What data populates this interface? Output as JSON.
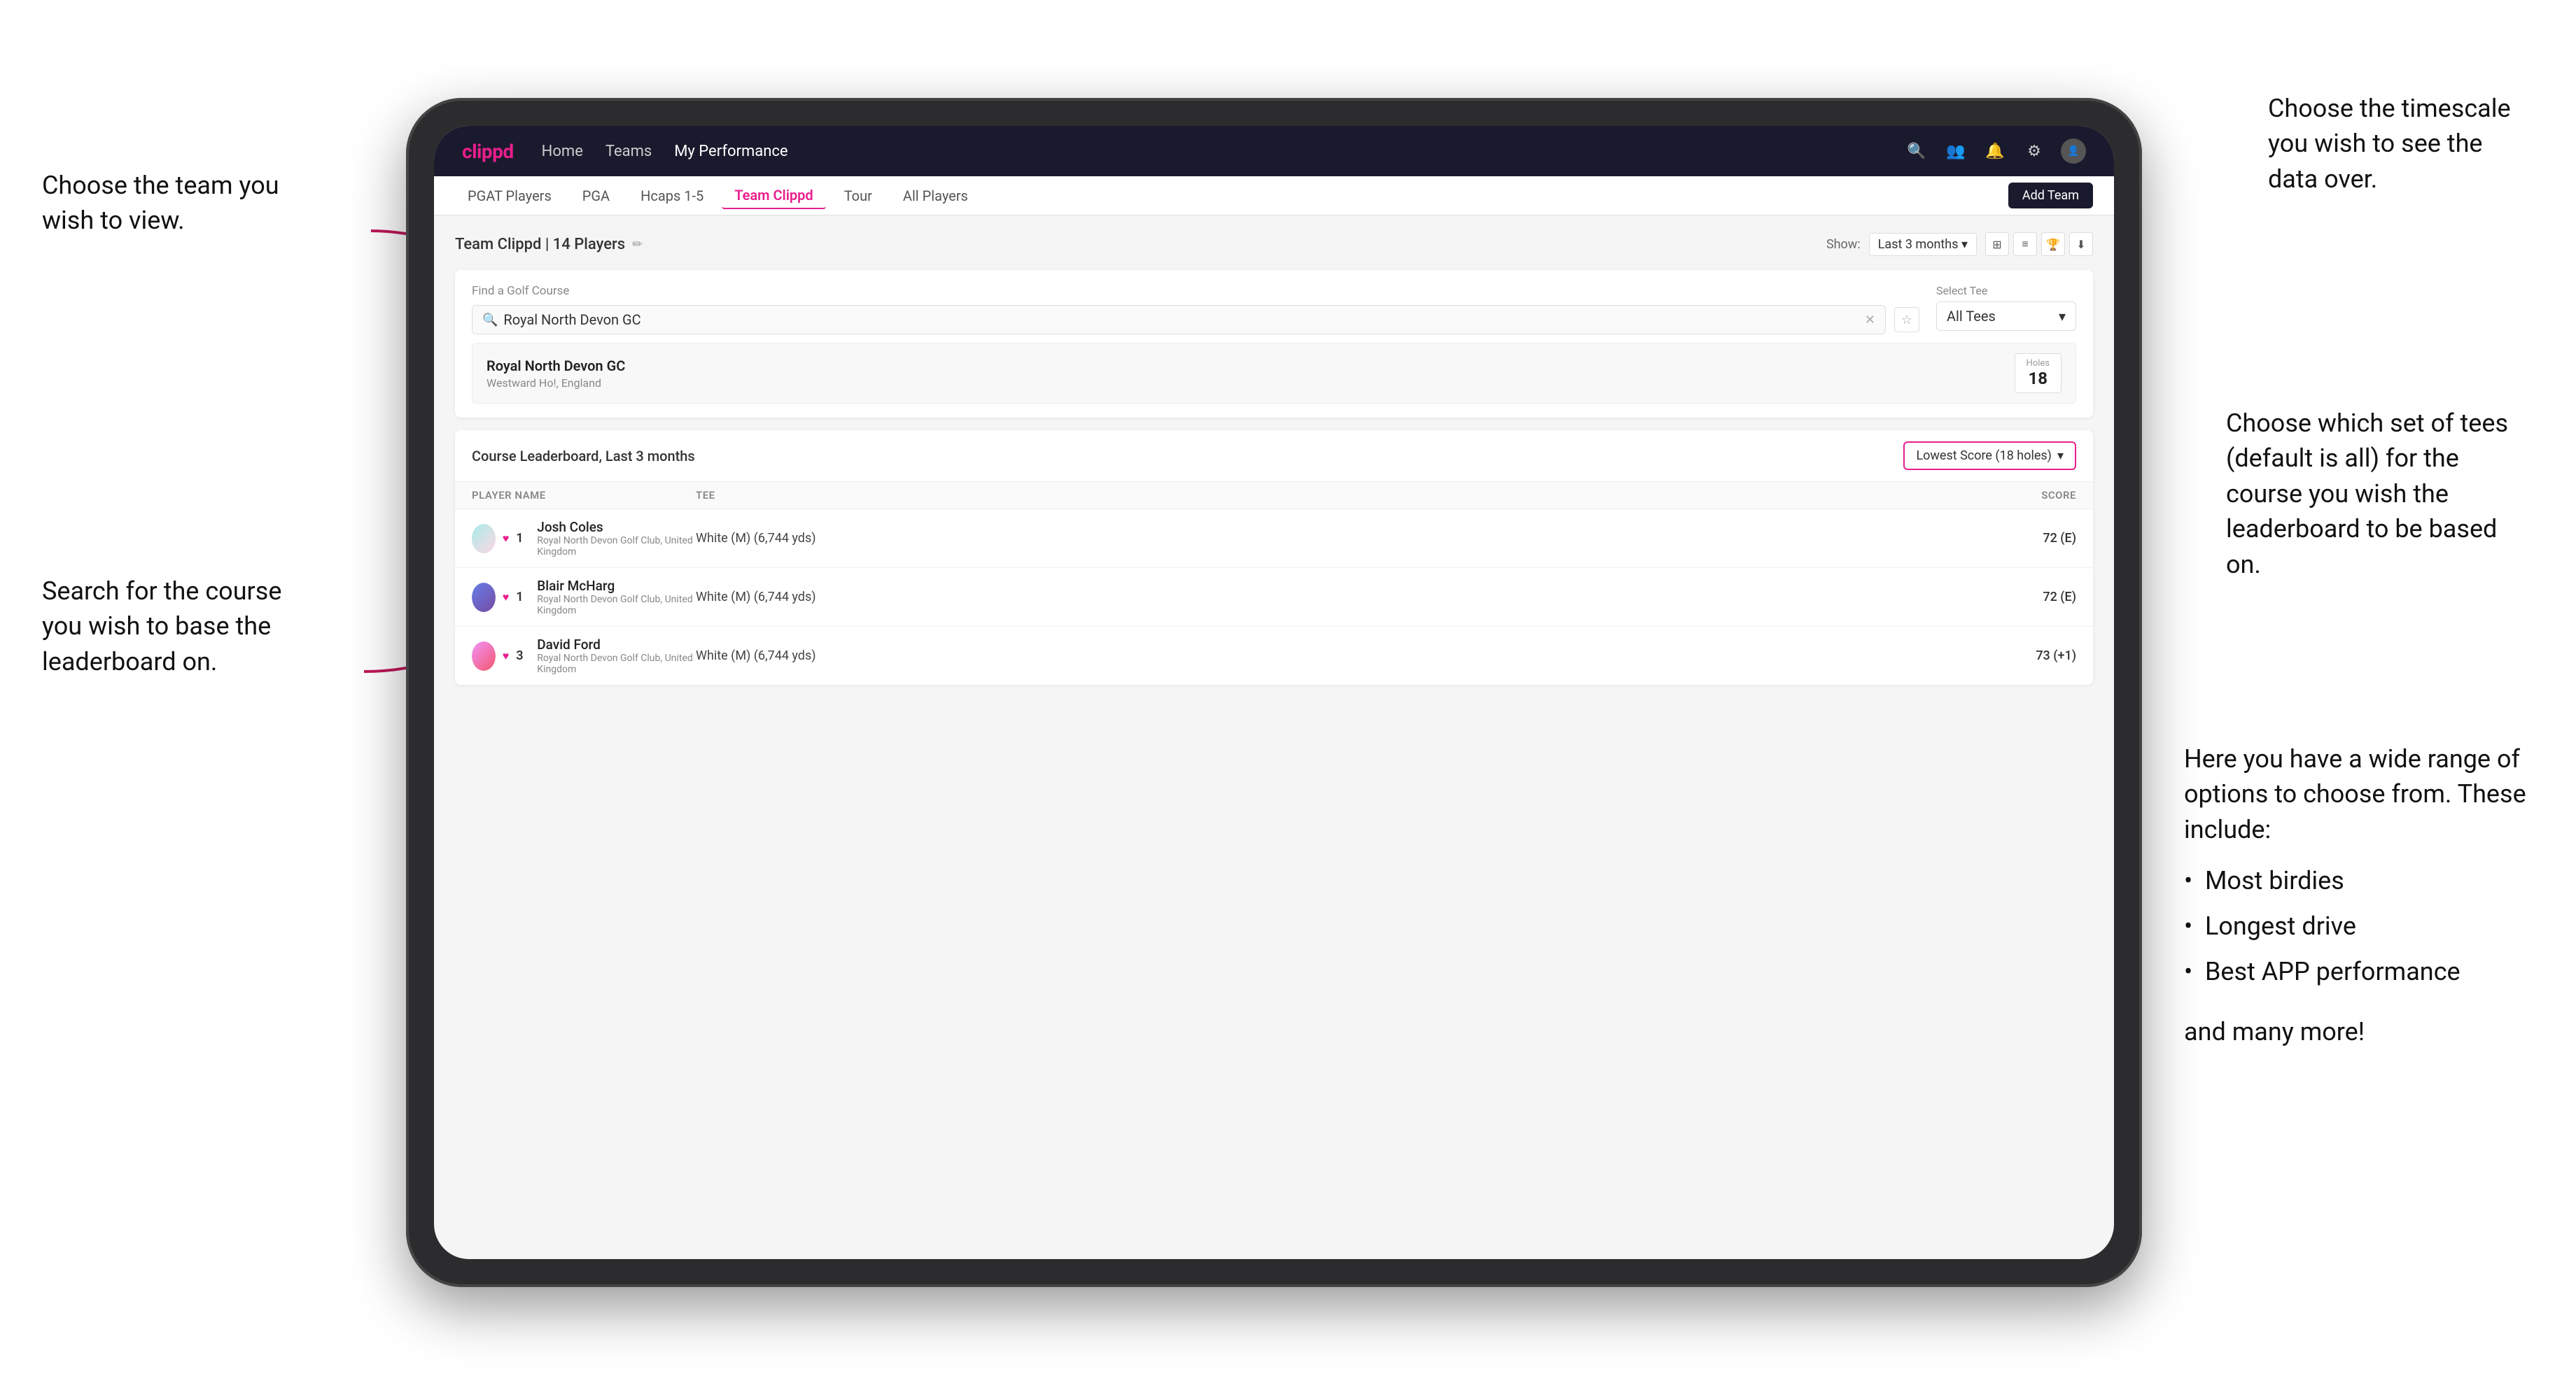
{
  "annotations": {
    "top_left_title": "Choose the team you wish to view.",
    "top_right_title": "Choose the timescale you wish to see the data over.",
    "middle_left_title": "Search for the course you wish to base the leaderboard on.",
    "right_middle_title": "Choose which set of tees (default is all) for the course you wish the leaderboard to be based on.",
    "bottom_right_title": "Here you have a wide range of options to choose from. These include:",
    "bottom_right_bullets": [
      "Most birdies",
      "Longest drive",
      "Best APP performance"
    ],
    "bottom_right_extra": "and many more!"
  },
  "navbar": {
    "brand": "clippd",
    "links": [
      "Home",
      "Teams",
      "My Performance"
    ],
    "active_link": "My Performance"
  },
  "subnav": {
    "tabs": [
      "PGAT Players",
      "PGA",
      "Hcaps 1-5",
      "Team Clippd",
      "Tour",
      "All Players"
    ],
    "active_tab": "Team Clippd",
    "add_team_label": "Add Team"
  },
  "team_header": {
    "title": "Team Clippd | 14 Players",
    "show_label": "Show:",
    "show_value": "Last 3 months"
  },
  "search_section": {
    "find_label": "Find a Golf Course",
    "search_value": "Royal North Devon GC",
    "tee_label": "Select Tee",
    "tee_value": "All Tees"
  },
  "course_result": {
    "name": "Royal North Devon GC",
    "location": "Westward Ho!, England",
    "holes_label": "Holes",
    "holes_value": "18"
  },
  "leaderboard": {
    "title": "Course Leaderboard, Last 3 months",
    "score_type": "Lowest Score (18 holes)",
    "columns": [
      "PLAYER NAME",
      "TEE",
      "SCORE"
    ],
    "rows": [
      {
        "rank": "1",
        "name": "Josh Coles",
        "club": "Royal North Devon Golf Club, United Kingdom",
        "tee": "White (M) (6,744 yds)",
        "score": "72 (E)"
      },
      {
        "rank": "1",
        "name": "Blair McHarg",
        "club": "Royal North Devon Golf Club, United Kingdom",
        "tee": "White (M) (6,744 yds)",
        "score": "72 (E)"
      },
      {
        "rank": "3",
        "name": "David Ford",
        "club": "Royal North Devon Golf Club, United Kingdom",
        "tee": "White (M) (6,744 yds)",
        "score": "73 (+1)"
      }
    ]
  }
}
